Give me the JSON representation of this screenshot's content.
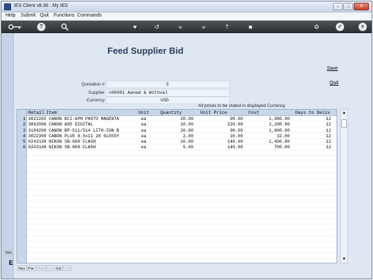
{
  "window": {
    "title": "IES Client v8.36 : My IES",
    "minimize": "–",
    "maximize": "□",
    "close": "✕"
  },
  "menu": [
    "Help",
    "Submit",
    "Quit",
    "Functions",
    "Commands"
  ],
  "toolbar": {
    "icons": [
      "key-icon",
      "help-icon",
      "search-icon",
      "heart-icon",
      "undo-icon",
      "rewind-icon",
      "fast-forward-icon",
      "export-icon",
      "stop-icon",
      "settings-icon",
      "check-icon",
      "close-icon"
    ]
  },
  "left": {
    "small_text": "Ses",
    "big_text": "E"
  },
  "form": {
    "title": "Feed Supplier Bid",
    "save": "Save",
    "quit": "Quit",
    "fields": {
      "quotation_label": "Quotation #",
      "quotation_value": "3",
      "supplier_label": "Supplier",
      "supplier_value": "c00001 Aanad & Withval",
      "currency_label": "Currency",
      "currency_value": "USD"
    },
    "note": "All prices to be stated in displayed Currency"
  },
  "grid": {
    "headers": {
      "retail": "Retail",
      "item": "Item",
      "unit": "Unit",
      "quantity": "Quantity",
      "unit_price": "Unit Price",
      "cost": "Cost",
      "days": "Days to Deliv"
    },
    "rows": [
      {
        "n": "1",
        "retail": "3022265",
        "item": "CANON BCI-6PM PHOTO MAGENTA",
        "unit": "ea",
        "quantity": "20.00",
        "unit_price": "99.00",
        "cost": "1,980.00",
        "days": "12"
      },
      {
        "n": "2",
        "retail": "3002096",
        "item": "CANON A95 DIGITAL",
        "unit": "ea",
        "quantity": "10.00",
        "unit_price": "220.00",
        "cost": "2,200.00",
        "days": "12"
      },
      {
        "n": "3",
        "retail": "3104290",
        "item": "CANON BP-511/514 LITH-ION B",
        "unit": "ea",
        "quantity": "20.00",
        "unit_price": "90.00",
        "cost": "1,800.00",
        "days": "12"
      },
      {
        "n": "4",
        "retail": "3022308",
        "item": "CANON PLUS 8.5x11 20 GLOSSY",
        "unit": "ea",
        "quantity": "2.00",
        "unit_price": "16.00",
        "cost": "32.00",
        "days": "12"
      },
      {
        "n": "5",
        "retail": "0243138",
        "item": "NIKON SB-600 FLASH",
        "unit": "ea",
        "quantity": "10.00",
        "unit_price": "140.00",
        "cost": "1,400.00",
        "days": "12"
      },
      {
        "n": "6",
        "retail": "0243140",
        "item": "NIKON SB-800 FLASH",
        "unit": "ea",
        "quantity": "5.00",
        "unit_price": "140.00",
        "cost": "700.00",
        "days": "12"
      }
    ]
  },
  "bottom_buttons": [
    {
      "label": "Nex",
      "enabled": true
    },
    {
      "label": "Pre",
      "enabled": true
    },
    {
      "label": "Add",
      "enabled": false
    },
    {
      "label": "Ins",
      "enabled": false
    },
    {
      "label": "Ed",
      "enabled": true
    },
    {
      "label": "Del",
      "enabled": false
    }
  ],
  "scroll": {
    "up": "▲",
    "down": "▼"
  }
}
